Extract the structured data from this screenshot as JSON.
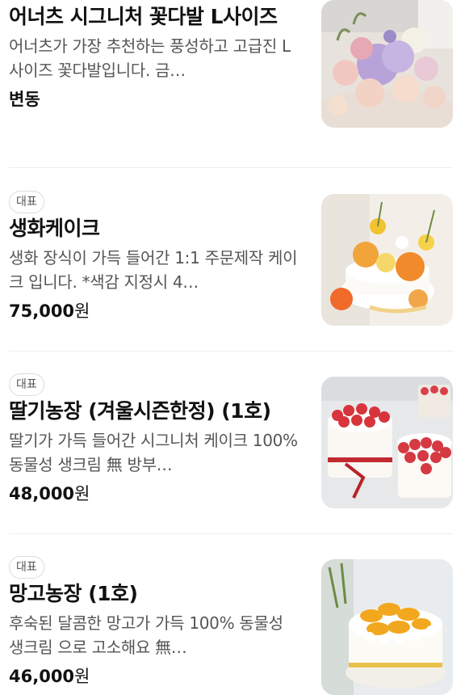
{
  "products": [
    {
      "badge": "",
      "title": "어너츠 시그니처 꽃다발 L사이즈",
      "description": "어너츠가 가장 추천하는 풍성하고 고급진 L사이즈 꽃다발입니다. 금…",
      "price": "변동",
      "currency": ""
    },
    {
      "badge": "대표",
      "title": "생화케이크",
      "description": "생화 장식이 가득 들어간 1:1 주문제작 케이크 입니다. *색감 지정시 4…",
      "price": "75,000",
      "currency": "원"
    },
    {
      "badge": "대표",
      "title": "딸기농장 (겨울시즌한정) (1호)",
      "description": "딸기가 가득 들어간 시그니처 케이크 100% 동물성 생크림 無 방부…",
      "price": "48,000",
      "currency": "원"
    },
    {
      "badge": "대표",
      "title": "망고농장 (1호)",
      "description": "후숙된 달콤한 망고가 가득 100% 동물성 생크림 으로 고소해요 無…",
      "price": "46,000",
      "currency": "원"
    }
  ],
  "colors": {
    "text": "#111111",
    "description": "#555555",
    "badge_border": "#dcdcdc",
    "divider": "#eeeeee"
  },
  "icons": [
    "bouquet-photo",
    "flower-cake-photo",
    "strawberry-cake-photo",
    "mango-cake-photo"
  ]
}
